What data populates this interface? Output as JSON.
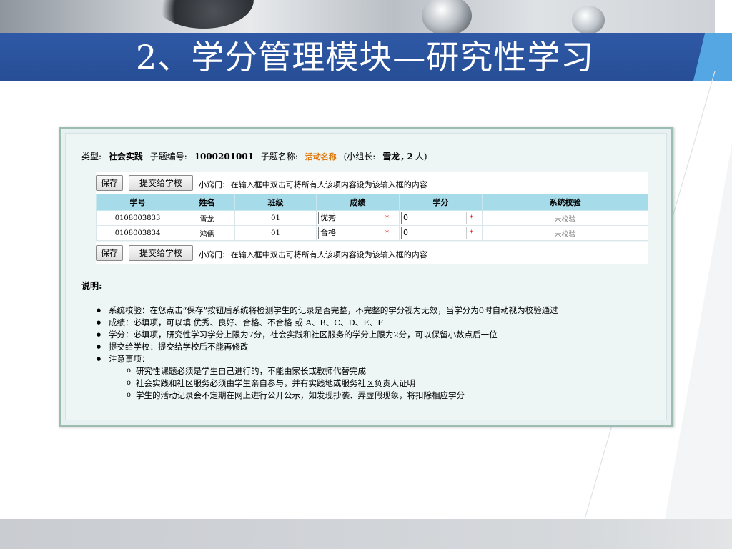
{
  "slide": {
    "title": "2、学分管理模块—研究性学习"
  },
  "meta": {
    "type_label": "类型:",
    "type_value": "社会实践",
    "topic_no_label": "子题编号:",
    "topic_no_value": "1000201001",
    "topic_name_label": "子题名称:",
    "topic_name_value": "活动名称",
    "leader_label": "(小组长:",
    "leader_value": "雪龙",
    "member_count": ", 2",
    "member_unit": "人)"
  },
  "toolbar": {
    "save_label": "保存",
    "submit_label": "提交给学校",
    "tip_label": "小窍门:",
    "tip_text": "在输入框中双击可将所有人该项内容设为该输入框的内容"
  },
  "table": {
    "columns": [
      "学号",
      "姓名",
      "班级",
      "成绩",
      "学分",
      "系统校验"
    ],
    "rows": [
      {
        "id": "0108003833",
        "name": "雪龙",
        "class": "01",
        "grade": "优秀",
        "credit": "0",
        "check": "未校验"
      },
      {
        "id": "0108003834",
        "name": "鸿儒",
        "class": "01",
        "grade": "合格",
        "credit": "0",
        "check": "未校验"
      }
    ],
    "required_mark": "*"
  },
  "notes": {
    "heading": "说明:",
    "items": [
      "系统校验：在您点击“保存”按钮后系统将检测学生的记录是否完整，不完整的学分视为无效，当学分为0时自动视为校验通过",
      "成绩：必填项，可以填 优秀、良好、合格、不合格 或 A、B、C、D、E、F",
      "学分：必填项，研究性学习学分上限为7分，社会实践和社区服务的学分上限为2分，可以保留小数点后一位",
      "提交给学校：提交给学校后不能再修改",
      "注意事项："
    ],
    "sub_items": [
      "研究性课题必须是学生自己进行的，不能由家长或教师代替完成",
      "社会实践和社区服务必须由学生亲自参与，并有实践地或服务社区负责人证明",
      "学生的活动记录会不定期在网上进行公开公示，如发现抄袭、弄虚假现象，将扣除相应学分"
    ]
  },
  "colors": {
    "title_band": "#2f59a6",
    "header_row": "#a6dcea",
    "panel_border": "#9cbdb2",
    "accent_orange": "#e07a0e",
    "required_red": "#dd0000"
  }
}
